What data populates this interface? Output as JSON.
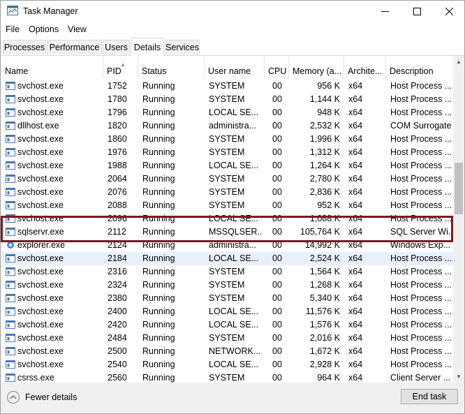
{
  "window": {
    "title": "Task Manager"
  },
  "menu": [
    "File",
    "Options",
    "View"
  ],
  "tabs": [
    "Processes",
    "Performance",
    "Users",
    "Details",
    "Services"
  ],
  "columns": [
    "Name",
    "PID",
    "Status",
    "User name",
    "CPU",
    "Memory (a...",
    "Archite...",
    "Description"
  ],
  "rows": [
    {
      "name": "svchost.exe",
      "pid": "1752",
      "status": "Running",
      "user": "SYSTEM",
      "cpu": "00",
      "mem": "956 K",
      "arch": "x64",
      "desc": "Host Process ...",
      "icon": "service-icon"
    },
    {
      "name": "svchost.exe",
      "pid": "1780",
      "status": "Running",
      "user": "SYSTEM",
      "cpu": "00",
      "mem": "1,144 K",
      "arch": "x64",
      "desc": "Host Process ...",
      "icon": "service-icon"
    },
    {
      "name": "svchost.exe",
      "pid": "1796",
      "status": "Running",
      "user": "LOCAL SE...",
      "cpu": "00",
      "mem": "948 K",
      "arch": "x64",
      "desc": "Host Process ...",
      "icon": "service-icon"
    },
    {
      "name": "dllhost.exe",
      "pid": "1820",
      "status": "Running",
      "user": "administra...",
      "cpu": "00",
      "mem": "2,532 K",
      "arch": "x64",
      "desc": "COM Surrogate",
      "icon": "service-icon"
    },
    {
      "name": "svchost.exe",
      "pid": "1860",
      "status": "Running",
      "user": "SYSTEM",
      "cpu": "00",
      "mem": "1,996 K",
      "arch": "x64",
      "desc": "Host Process ...",
      "icon": "service-icon"
    },
    {
      "name": "svchost.exe",
      "pid": "1976",
      "status": "Running",
      "user": "SYSTEM",
      "cpu": "00",
      "mem": "1,312 K",
      "arch": "x64",
      "desc": "Host Process ...",
      "icon": "service-icon"
    },
    {
      "name": "svchost.exe",
      "pid": "1988",
      "status": "Running",
      "user": "LOCAL SE...",
      "cpu": "00",
      "mem": "1,264 K",
      "arch": "x64",
      "desc": "Host Process ...",
      "icon": "service-icon"
    },
    {
      "name": "svchost.exe",
      "pid": "2064",
      "status": "Running",
      "user": "SYSTEM",
      "cpu": "00",
      "mem": "2,780 K",
      "arch": "x64",
      "desc": "Host Process ...",
      "icon": "service-icon"
    },
    {
      "name": "svchost.exe",
      "pid": "2076",
      "status": "Running",
      "user": "SYSTEM",
      "cpu": "00",
      "mem": "2,836 K",
      "arch": "x64",
      "desc": "Host Process ...",
      "icon": "service-icon"
    },
    {
      "name": "svchost.exe",
      "pid": "2088",
      "status": "Running",
      "user": "SYSTEM",
      "cpu": "00",
      "mem": "952 K",
      "arch": "x64",
      "desc": "Host Process ...",
      "icon": "service-icon"
    },
    {
      "name": "svchost.exe",
      "pid": "2096",
      "status": "Running",
      "user": "LOCAL SE...",
      "cpu": "00",
      "mem": "1,088 K",
      "arch": "x64",
      "desc": "Host Process ...",
      "icon": "service-icon"
    },
    {
      "name": "sqlservr.exe",
      "pid": "2112",
      "status": "Running",
      "user": "MSSQLSER...",
      "cpu": "00",
      "mem": "105,764 K",
      "arch": "x64",
      "desc": "SQL Server Wi...",
      "icon": "service-icon"
    },
    {
      "name": "explorer.exe",
      "pid": "2124",
      "status": "Running",
      "user": "administra...",
      "cpu": "00",
      "mem": "14,992 K",
      "arch": "x64",
      "desc": "Windows Exp...",
      "icon": "explorer-icon"
    },
    {
      "name": "svchost.exe",
      "pid": "2184",
      "status": "Running",
      "user": "LOCAL SE...",
      "cpu": "00",
      "mem": "2,524 K",
      "arch": "x64",
      "desc": "Host Process ...",
      "icon": "service-icon",
      "selected": true
    },
    {
      "name": "svchost.exe",
      "pid": "2316",
      "status": "Running",
      "user": "SYSTEM",
      "cpu": "00",
      "mem": "1,564 K",
      "arch": "x64",
      "desc": "Host Process ...",
      "icon": "service-icon"
    },
    {
      "name": "svchost.exe",
      "pid": "2324",
      "status": "Running",
      "user": "SYSTEM",
      "cpu": "00",
      "mem": "1,268 K",
      "arch": "x64",
      "desc": "Host Process ...",
      "icon": "service-icon"
    },
    {
      "name": "svchost.exe",
      "pid": "2380",
      "status": "Running",
      "user": "SYSTEM",
      "cpu": "00",
      "mem": "5,340 K",
      "arch": "x64",
      "desc": "Host Process ...",
      "icon": "service-icon"
    },
    {
      "name": "svchost.exe",
      "pid": "2400",
      "status": "Running",
      "user": "LOCAL SE...",
      "cpu": "00",
      "mem": "11,576 K",
      "arch": "x64",
      "desc": "Host Process ...",
      "icon": "service-icon"
    },
    {
      "name": "svchost.exe",
      "pid": "2420",
      "status": "Running",
      "user": "LOCAL SE...",
      "cpu": "00",
      "mem": "1,576 K",
      "arch": "x64",
      "desc": "Host Process ...",
      "icon": "service-icon"
    },
    {
      "name": "svchost.exe",
      "pid": "2484",
      "status": "Running",
      "user": "SYSTEM",
      "cpu": "00",
      "mem": "2,016 K",
      "arch": "x64",
      "desc": "Host Process ...",
      "icon": "service-icon"
    },
    {
      "name": "svchost.exe",
      "pid": "2500",
      "status": "Running",
      "user": "NETWORK...",
      "cpu": "00",
      "mem": "1,672 K",
      "arch": "x64",
      "desc": "Host Process ...",
      "icon": "service-icon"
    },
    {
      "name": "svchost.exe",
      "pid": "2540",
      "status": "Running",
      "user": "LOCAL SE...",
      "cpu": "00",
      "mem": "2,928 K",
      "arch": "x64",
      "desc": "Host Process ...",
      "icon": "service-icon"
    },
    {
      "name": "csrss.exe",
      "pid": "2560",
      "status": "Running",
      "user": "SYSTEM",
      "cpu": "00",
      "mem": "964 K",
      "arch": "x64",
      "desc": "Client Server ...",
      "icon": "service-icon"
    }
  ],
  "footer": {
    "fewer_details": "Fewer details",
    "end_task": "End task"
  },
  "colors": {
    "highlight": "#7b1a24",
    "selected_row": "#e8f1fb",
    "accent": "#1e5aa8"
  }
}
